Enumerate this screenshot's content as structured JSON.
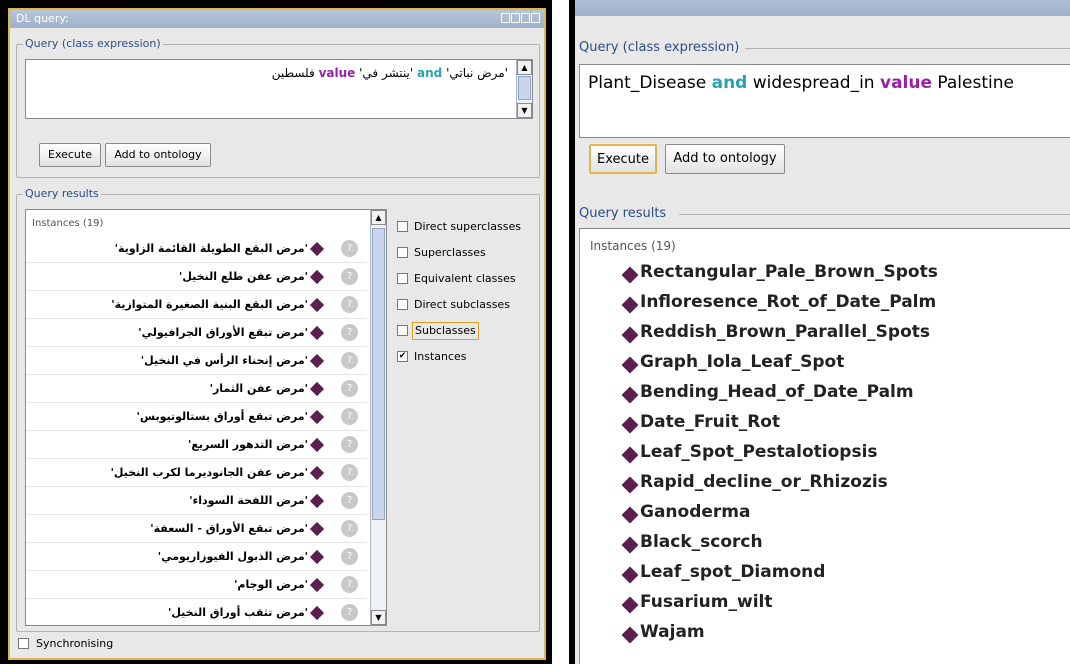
{
  "left": {
    "window_title": "DL query:",
    "query_group_label": "Query (class expression)",
    "query": {
      "arg1": "'مرض نباتي'",
      "kw_and": "and",
      "arg2": "'ينتشر في'",
      "kw_value": "value",
      "arg3": "فلسطين"
    },
    "execute_label": "Execute",
    "add_label": "Add to ontology",
    "results_group_label": "Query results",
    "instances_label": "Instances (19)",
    "help_glyph": "?",
    "instances": [
      "'مرض البقع الطويلة القائمة الزاوية'",
      "'مرض عفن طلع النخيل'",
      "'مرض البقع البنية الصغيرة المتوازية'",
      "'مرض تبقع الأوراق الجرافيولي'",
      "'مرض إنحناء الرأس في النخيل'",
      "'مرض عفن الثمار'",
      "'مرض تبقع أوراق بستالوتيوبس'",
      "'مرض التدهور السريع'",
      "'مرض عفن الجانوديرما لكرب النخيل'",
      "'مرض اللفحة السوداء'",
      "'مرض تبقع الأوراق - السعفة'",
      "'مرض الذبول الفيوزاريومي'",
      "'مرض الوجام'",
      "'مرض تثقب أوراق النخيل'"
    ],
    "options": [
      {
        "label": "Direct superclasses",
        "checked": false
      },
      {
        "label": "Superclasses",
        "checked": false
      },
      {
        "label": "Equivalent classes",
        "checked": false
      },
      {
        "label": "Direct subclasses",
        "checked": false
      },
      {
        "label": "Subclasses",
        "checked": false
      },
      {
        "label": "Instances",
        "checked": true
      }
    ],
    "checkmark": "✔",
    "sync_label": "Synchronising"
  },
  "right": {
    "query_group_label": "Query (class expression)",
    "query": {
      "arg1": "Plant_Disease",
      "kw_and": "and",
      "arg2": "widespread_in",
      "kw_value": "value",
      "arg3": "Palestine"
    },
    "execute_label": "Execute",
    "add_label": "Add to ontology",
    "results_group_label": "Query results",
    "instances_label": "Instances (19)",
    "instances": [
      "Rectangular_Pale_Brown_Spots",
      "Infloresence_Rot_of_Date_Palm",
      "Reddish_Brown_Parallel_Spots",
      "Graph_Iola_Leaf_Spot",
      "Bending_Head_of_Date_Palm",
      "Date_Fruit_Rot",
      "Leaf_Spot_Pestalotiopsis",
      "Rapid_decline_or_Rhizozis",
      "Ganoderma",
      "Black_scorch",
      "Leaf_spot_Diamond",
      "Fusarium_wilt",
      "Wajam"
    ]
  },
  "colors": {
    "and_keyword": "#2aa3b0",
    "value_keyword": "#9b1fa8",
    "highlight_border": "#e0b64a",
    "diamond": "#5b1f4f"
  }
}
